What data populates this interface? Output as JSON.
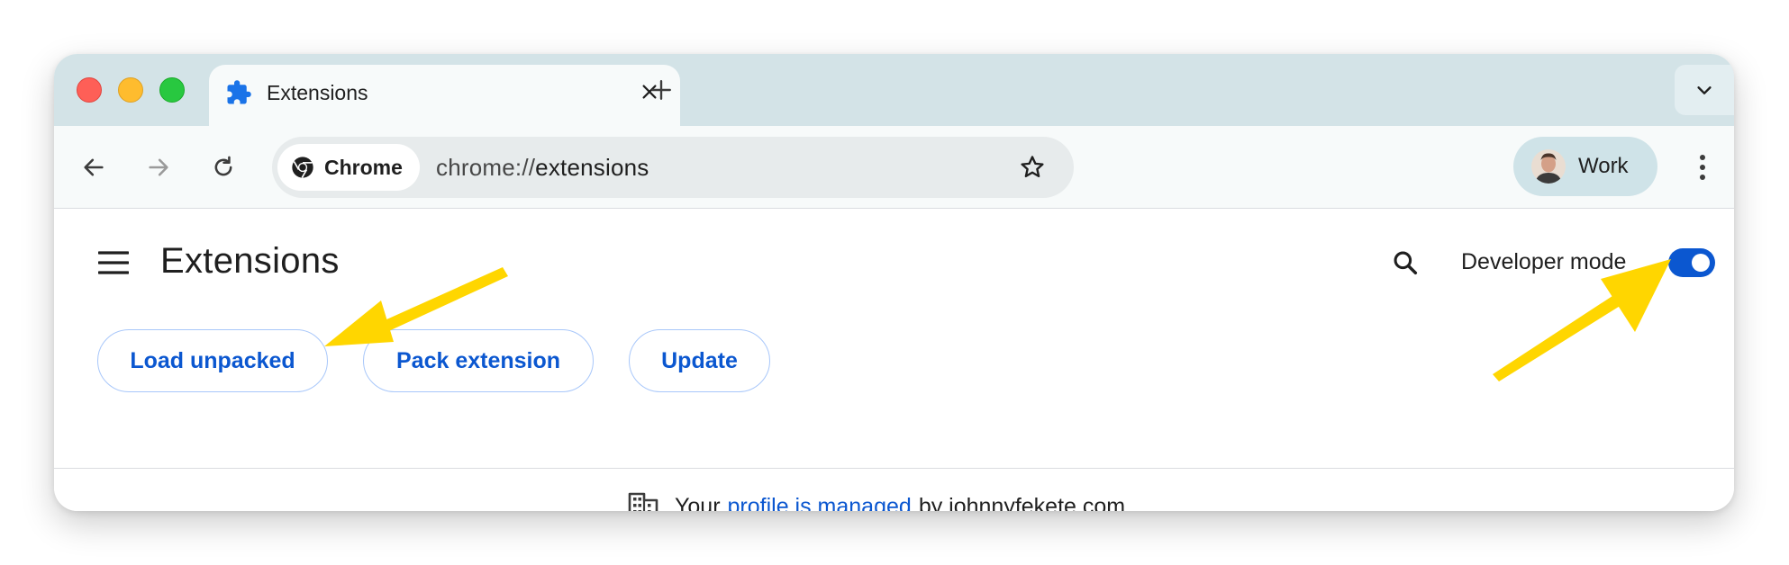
{
  "window": {
    "controls": [
      "close",
      "minimize",
      "maximize"
    ]
  },
  "tabs": [
    {
      "title": "Extensions",
      "icon": "puzzle-icon",
      "active": true
    }
  ],
  "toolbar": {
    "omnibox_chip_label": "Chrome",
    "url_scheme": "chrome://",
    "url_path": "extensions",
    "profile_name": "Work"
  },
  "page": {
    "title": "Extensions",
    "developer_mode_label": "Developer mode",
    "developer_mode_on": true,
    "buttons": {
      "load_unpacked": "Load unpacked",
      "pack_extension": "Pack extension",
      "update": "Update"
    },
    "managed_notice": {
      "prefix": "Your",
      "link": "profile is managed",
      "suffix": "by johnnyfekete.com"
    }
  },
  "colors": {
    "accent": "#0b57d0",
    "tabstrip": "#d3e3e7",
    "annotation_arrow": "#ffd600"
  }
}
